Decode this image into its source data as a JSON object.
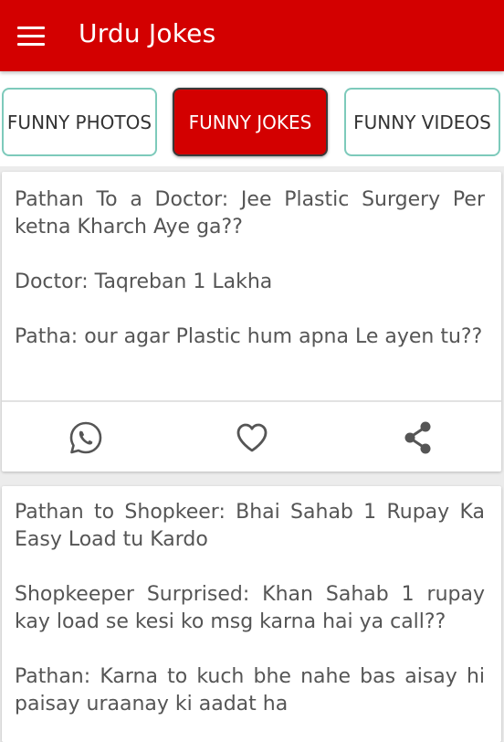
{
  "appbar": {
    "title": "Urdu Jokes",
    "color": "#d30000",
    "menu_icon": "hamburger-menu-icon"
  },
  "tabs": [
    {
      "label": "FUNNY PHOTOS",
      "active": false
    },
    {
      "label": "FUNNY JOKES",
      "active": true
    },
    {
      "label": "FUNNY VIDEOS",
      "active": false
    }
  ],
  "jokes": [
    {
      "paragraphs": [
        "Pathan To a Doctor: Jee Plastic Surgery Per ketna Kharch Aye ga??",
        "Doctor: Taqreban 1 Lakha",
        "Patha: our agar Plastic hum apna Le ayen tu??"
      ],
      "actions": [
        "whatsapp-icon",
        "heart-icon",
        "share-icon"
      ]
    },
    {
      "paragraphs": [
        "Pathan to Shopkeer: Bhai Sahab 1 Rupay Ka Easy Load tu Kardo",
        "Shopkeeper Surprised: Khan Sahab 1 rupay kay load se kesi ko msg karna hai ya call??",
        "Pathan: Karna to kuch bhe nahe bas aisay hi paisay uraanay ki aadat ha"
      ]
    }
  ]
}
